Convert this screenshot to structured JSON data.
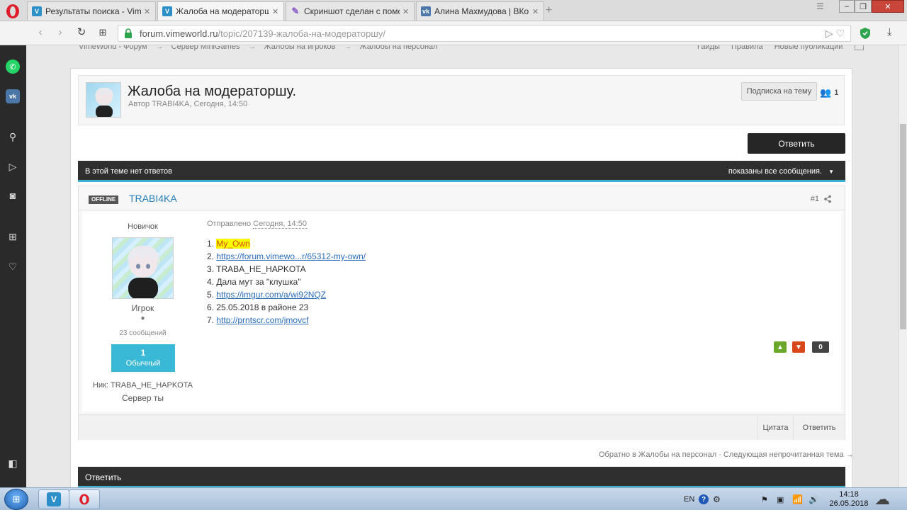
{
  "browser": {
    "tabs": [
      {
        "title": "Результаты поиска - Vime",
        "favicon": "vimeworld"
      },
      {
        "title": "Жалоба на модераторшу",
        "favicon": "vimeworld",
        "active": true
      },
      {
        "title": "Скриншот сделан с помо",
        "favicon": "feather"
      },
      {
        "title": "Алина Махмудова | ВКон",
        "favicon": "vk"
      }
    ],
    "url_host": "forum.vimeworld.ru",
    "url_path": "/topic/207139-жалоба-на-модераторшу/"
  },
  "breadcrumbs": [
    "VimeWorld - Форум",
    "Сервер MiniGames",
    "Жалобы на игроков",
    "Жалобы на персонал"
  ],
  "top_links": [
    "Гайды",
    "Правила",
    "Новые публикации"
  ],
  "topic": {
    "title": "Жалоба на модераторшу.",
    "meta": "Автор TRABI4KA, Сегодня, 14:50",
    "follow_label": "Подписка на тему",
    "followers": "1"
  },
  "reply_button": "Ответить",
  "bar": {
    "left": "В этой теме нет ответов",
    "right": "показаны все сообщения."
  },
  "post": {
    "status": "OFFLINE",
    "author": "TRABI4KA",
    "number": "#1",
    "rank_title": "Новичок",
    "group": "Игрок",
    "posts_count": "23 сообщений",
    "rep_value": "1",
    "rep_label": "Обычный",
    "nick_line": "Ник: TRABA_HE_HAPKOTA",
    "server_line": "Сервер ты",
    "posted_prefix": "Отправлено",
    "posted_time": "Сегодня, 14:50",
    "lines": [
      {
        "num": "1.",
        "text": "My_Own",
        "type": "highlight"
      },
      {
        "num": "2.",
        "text": "https://forum.vimewo...r/65312-my-own/",
        "type": "link"
      },
      {
        "num": "3.",
        "text": "TRABA_HE_HAPKOTA",
        "type": "text"
      },
      {
        "num": "4.",
        "text": "Дала мут за \"клушка\"",
        "type": "text"
      },
      {
        "num": "5.",
        "text": "https://imgur.com/a/wi92NQZ",
        "type": "link"
      },
      {
        "num": "6.",
        "text": "25.05.2018 в районе 23",
        "type": "text"
      },
      {
        "num": "7.",
        "text": "http://prntscr.com/jmovcf",
        "type": "link"
      }
    ],
    "vote_up": "▲",
    "vote_down": "▼",
    "vote_count": "0",
    "quote_label": "Цитата",
    "reply_label": "Ответить"
  },
  "nav_links": "Обратно в Жалобы на персонал · Следующая непрочитанная тема →",
  "reply_bar": "Ответить",
  "taskbar": {
    "lang": "EN",
    "time": "14:18",
    "date": "26.05.2018"
  },
  "colors": {
    "accent": "#3ab1d0",
    "author_link": "#2a7fb8",
    "highlight_bg": "#ffff00",
    "highlight_fg": "#d24a00",
    "vote_up": "#6aa72a",
    "vote_down": "#d9481a"
  }
}
